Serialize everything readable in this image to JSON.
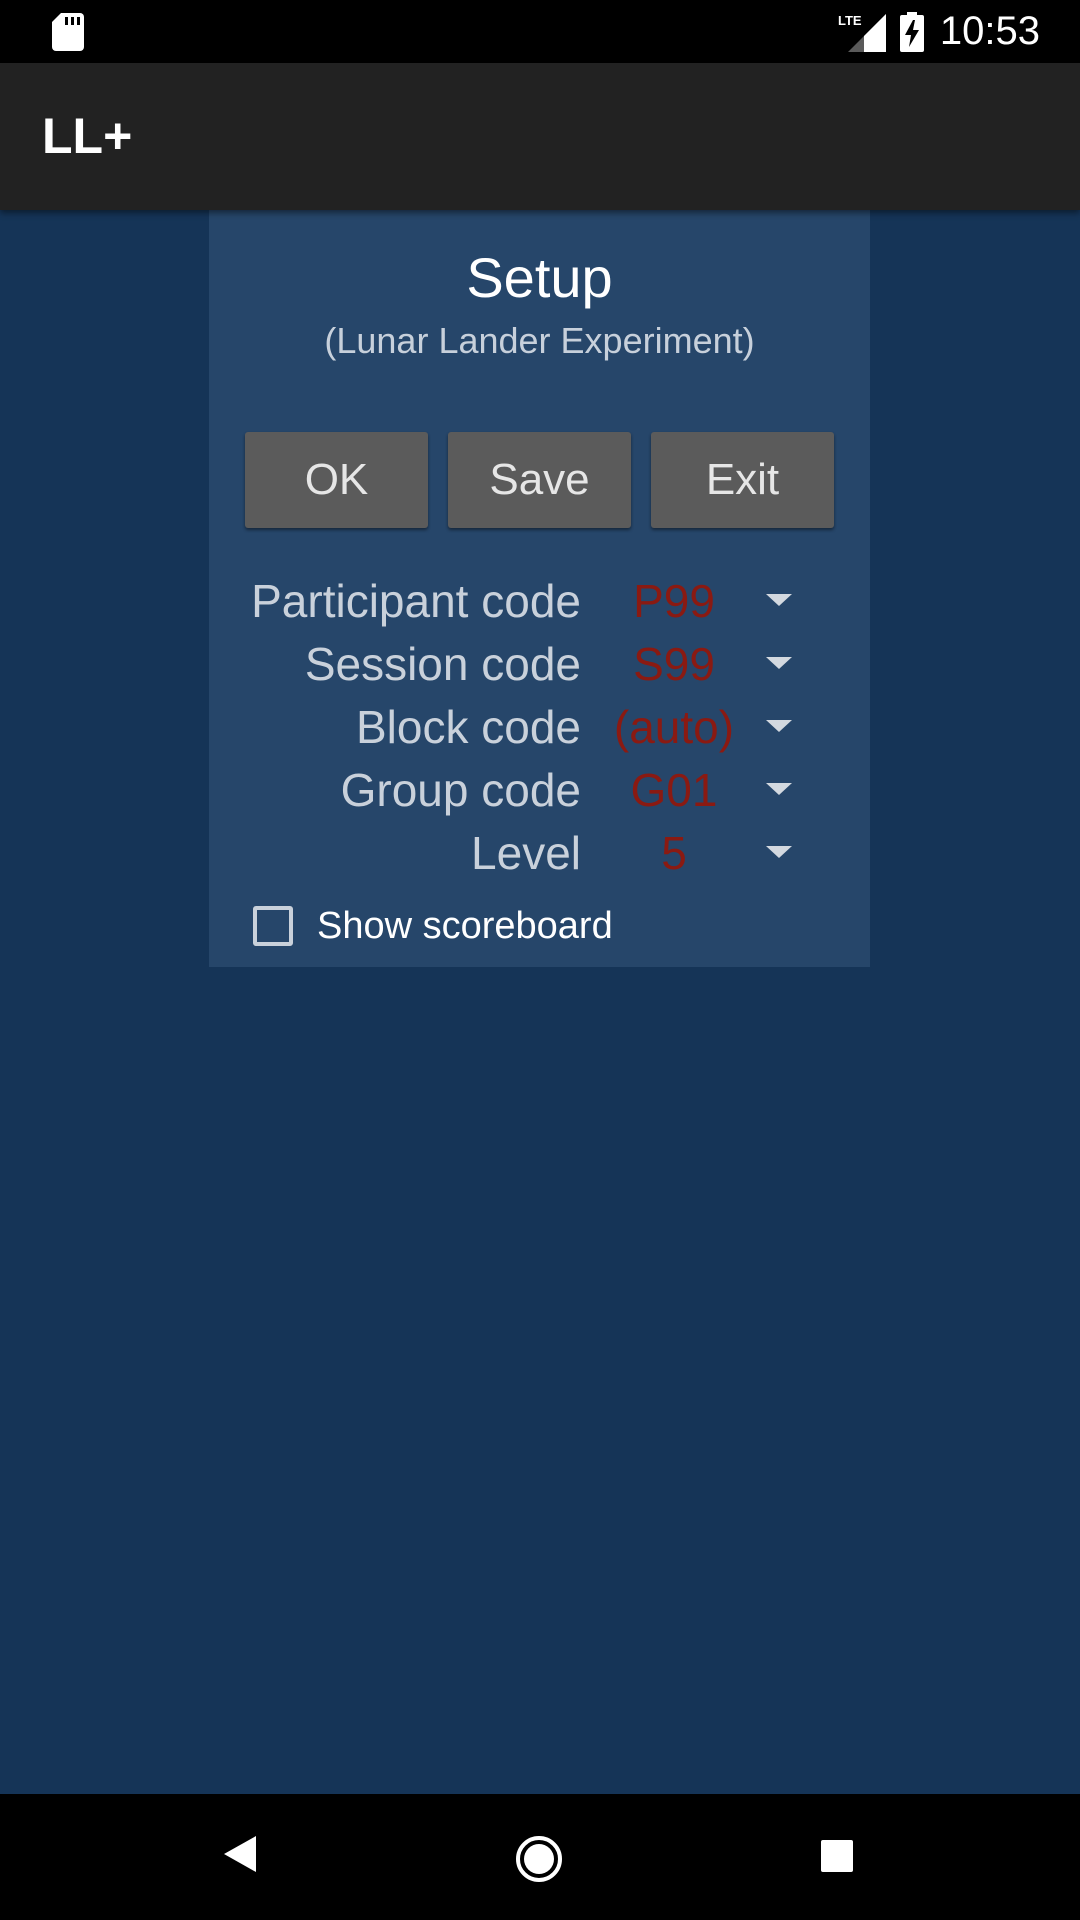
{
  "status_bar": {
    "time": "10:53",
    "network_label": "LTE",
    "icons": [
      "sd-card-icon",
      "lte-signal-icon",
      "battery-charging-icon"
    ]
  },
  "app_bar": {
    "title": "LL+"
  },
  "setup": {
    "title": "Setup",
    "subtitle": "(Lunar Lander Experiment)",
    "buttons": {
      "ok": "OK",
      "save": "Save",
      "exit": "Exit"
    },
    "fields": [
      {
        "label": "Participant code",
        "value": "P99"
      },
      {
        "label": "Session code",
        "value": "S99"
      },
      {
        "label": "Block code",
        "value": "(auto)"
      },
      {
        "label": "Group code",
        "value": "G01"
      },
      {
        "label": "Level",
        "value": "5"
      }
    ],
    "scoreboard": {
      "label": "Show scoreboard",
      "checked": false
    }
  },
  "nav_bar": {
    "icons": [
      "back-icon",
      "home-icon",
      "recents-icon"
    ]
  },
  "colors": {
    "background": "#153457",
    "panel": "#26466a",
    "app_bar": "#222222",
    "button": "#5b5b5b",
    "field_value": "#8a1a12"
  }
}
